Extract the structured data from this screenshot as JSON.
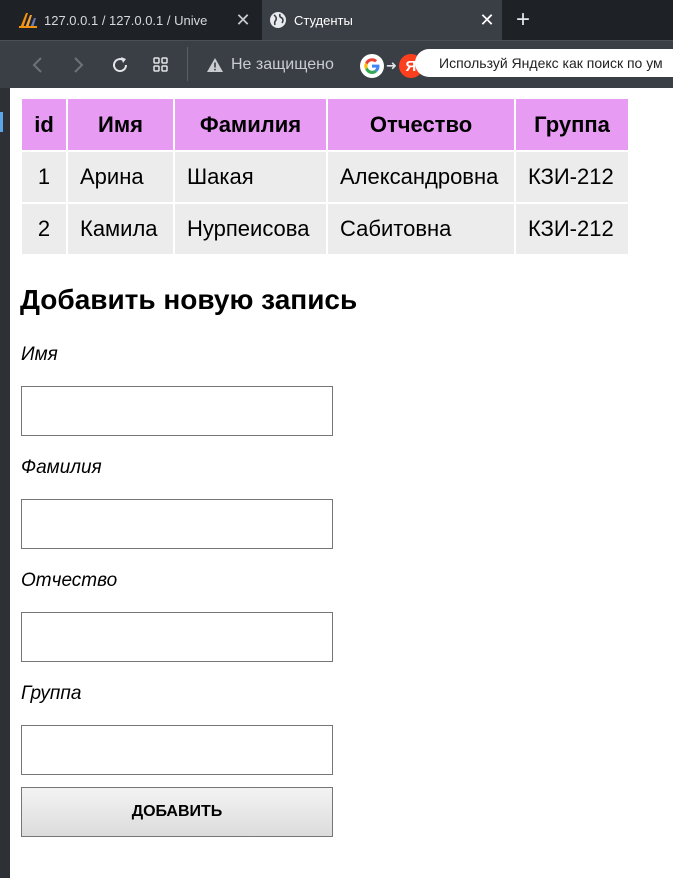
{
  "browser": {
    "tabs": [
      {
        "title": "127.0.0.1 / 127.0.0.1 / Unive",
        "active": false,
        "icon": "pma-icon"
      },
      {
        "title": "Студенты",
        "active": true,
        "icon": "globe-icon"
      }
    ],
    "security_label": "Не защищено",
    "promo_text": "Используй Яндекс как поиск по ум",
    "yandex_letter": "Я"
  },
  "table": {
    "headers": [
      "id",
      "Имя",
      "Фамилия",
      "Отчество",
      "Группа"
    ],
    "rows": [
      [
        "1",
        "Арина",
        "Шакая",
        "Александровна",
        "КЗИ-212"
      ],
      [
        "2",
        "Камила",
        "Нурпеисова",
        "Сабитовна",
        "КЗИ-212"
      ]
    ],
    "header_color": "#e79bf3",
    "cell_color": "#ececec"
  },
  "form": {
    "title": "Добавить новую запись",
    "fields": [
      {
        "label": "Имя",
        "value": ""
      },
      {
        "label": "Фамилия",
        "value": ""
      },
      {
        "label": "Отчество",
        "value": ""
      },
      {
        "label": "Группа",
        "value": ""
      }
    ],
    "submit_label": "ДОБАВИТЬ"
  }
}
